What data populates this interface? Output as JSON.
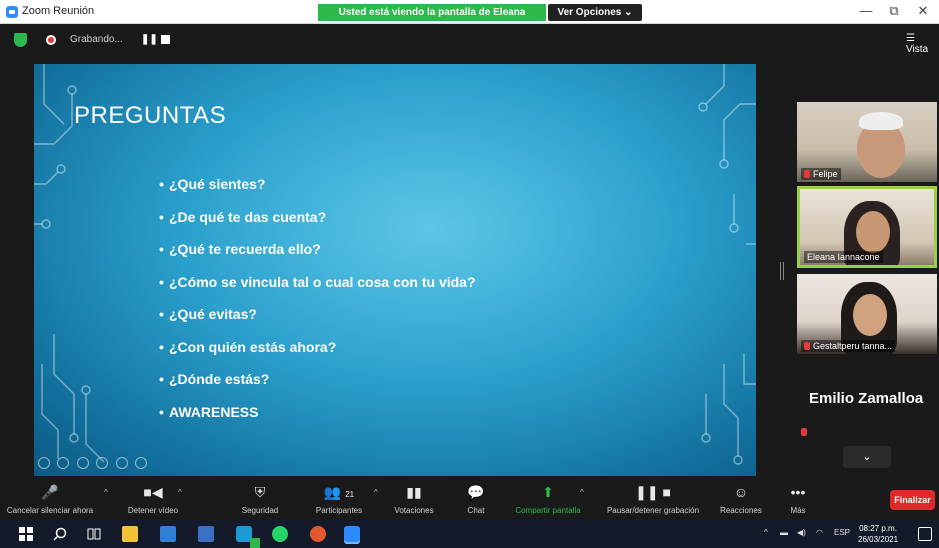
{
  "window": {
    "title": "Zoom Reunión",
    "share_banner": "Usted está viendo la pantalla de Eleana Iannacone",
    "view_options": "Ver Opciones ⌄",
    "minimize": "—",
    "maximize": "⧉",
    "close": "✕"
  },
  "recording": {
    "label": "Grabando...",
    "pause": "❚❚"
  },
  "view_button": "☰ Vista",
  "slide": {
    "title": "PREGUNTAS",
    "bullets": [
      "¿Qué sientes?",
      "¿De qué te das cuenta?",
      "¿Qué te recuerda ello?",
      "¿Cómo se vincula tal o cual cosa con tu vida?",
      "¿Qué evitas?",
      "¿Con quién estás ahora?",
      "¿Dónde estás?",
      "AWARENESS"
    ]
  },
  "participants": {
    "tiles": [
      {
        "name": "Felipe"
      },
      {
        "name": "Eleana Iannacone"
      },
      {
        "name": "Gestaltperu tanna..."
      }
    ],
    "name_only": "Emilio Zamalloa",
    "more": "⌄"
  },
  "toolbar": {
    "items": [
      {
        "label": "Cancelar silenciar ahora",
        "icon": "🎤"
      },
      {
        "label": "Detener vídeo",
        "icon": "■◀"
      },
      {
        "label": "Seguridad",
        "icon": "⛨"
      },
      {
        "label": "Participantes",
        "icon": "👥",
        "count": "21"
      },
      {
        "label": "Votaciones",
        "icon": "▮▮"
      },
      {
        "label": "Chat",
        "icon": "💬"
      },
      {
        "label": "Compartir pantalla",
        "icon": "⬆"
      },
      {
        "label": "Pausar/detener grabación",
        "icon": "❚❚ ■"
      },
      {
        "label": "Reacciones",
        "icon": "☺"
      },
      {
        "label": "Más",
        "icon": "•••"
      }
    ],
    "end_button": "Finalizar"
  },
  "taskbar": {
    "language": "ESP",
    "time": "08:27 p.m.",
    "date": "26/03/2021"
  },
  "colors": {
    "share_green": "#2db84b",
    "end_red": "#e02828",
    "active_speaker_border": "#9ad045"
  }
}
